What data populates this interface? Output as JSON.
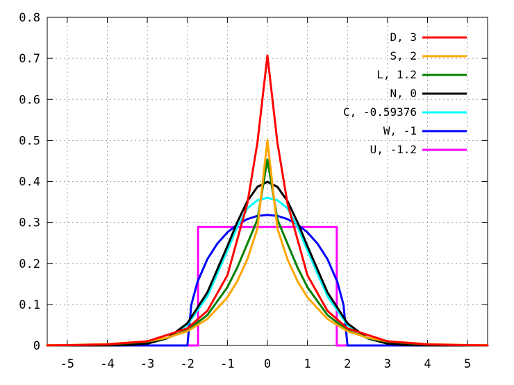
{
  "chart_data": {
    "type": "line",
    "title": "",
    "xlabel": "",
    "ylabel": "",
    "xlim": [
      -5.5,
      5.5
    ],
    "ylim": [
      0,
      0.8
    ],
    "x_ticks": [
      -5,
      -4,
      -3,
      -2,
      -1,
      0,
      1,
      2,
      3,
      4,
      5
    ],
    "x_tick_labels": [
      "-5",
      "-4",
      "-3",
      "-2",
      "-1",
      "0",
      "1",
      "2",
      "3",
      "4",
      "5"
    ],
    "y_ticks": [
      0,
      0.1,
      0.2,
      0.3,
      0.4,
      0.5,
      0.6,
      0.7,
      0.8
    ],
    "y_tick_labels": [
      "0",
      "0.1",
      "0.2",
      "0.3",
      "0.4",
      "0.5",
      "0.6",
      "0.7",
      "0.8"
    ],
    "grid": true,
    "legend_position": "top-right",
    "series": [
      {
        "name": "D, 3",
        "color": "#ff0000",
        "x": [
          -5.5,
          -5,
          -4,
          -3,
          -2,
          -1.5,
          -1,
          -0.5,
          -0.25,
          0,
          0.25,
          0.5,
          1,
          1.5,
          2,
          3,
          4,
          5,
          5.5
        ],
        "y": [
          0.0003,
          0.0006,
          0.0025,
          0.0101,
          0.0416,
          0.0843,
          0.171,
          0.3469,
          0.4941,
          0.7071,
          0.4941,
          0.3469,
          0.171,
          0.0843,
          0.0416,
          0.0101,
          0.0025,
          0.0006,
          0.0003
        ]
      },
      {
        "name": "S, 2",
        "color": "#ffa500",
        "x": [
          -5.5,
          -5,
          -4,
          -3,
          -2.5,
          -2,
          -1.5,
          -1,
          -0.75,
          -0.5,
          -0.25,
          0,
          0.25,
          0.5,
          0.75,
          1,
          1.5,
          2,
          2.5,
          3,
          4,
          5,
          5.5
        ],
        "y": [
          0.0007,
          0.0011,
          0.0033,
          0.0102,
          0.0189,
          0.0348,
          0.0645,
          0.1172,
          0.1572,
          0.2102,
          0.285,
          0.5,
          0.285,
          0.2102,
          0.1572,
          0.1172,
          0.0645,
          0.0348,
          0.0189,
          0.0102,
          0.0033,
          0.0011,
          0.0007
        ]
      },
      {
        "name": "L, 1.2",
        "color": "#008000",
        "x": [
          -5.5,
          -5,
          -4,
          -3,
          -2.5,
          -2,
          -1.5,
          -1,
          -0.75,
          -0.5,
          -0.25,
          0,
          0.25,
          0.5,
          0.75,
          1,
          1.5,
          2,
          2.5,
          3,
          4,
          5,
          5.5
        ],
        "y": [
          0.0003,
          0.0005,
          0.0022,
          0.0089,
          0.0182,
          0.037,
          0.0742,
          0.1419,
          0.1906,
          0.2484,
          0.3068,
          0.4534,
          0.3068,
          0.2484,
          0.1906,
          0.1419,
          0.0742,
          0.037,
          0.0182,
          0.0089,
          0.0022,
          0.0005,
          0.0003
        ]
      },
      {
        "name": "N, 0",
        "color": "#000000",
        "x": [
          -5.5,
          -5,
          -4,
          -3.5,
          -3,
          -2.5,
          -2,
          -1.5,
          -1,
          -0.75,
          -0.5,
          -0.25,
          0,
          0.25,
          0.5,
          0.75,
          1,
          1.5,
          2,
          2.5,
          3,
          3.5,
          4,
          5,
          5.5
        ],
        "y": [
          0.0,
          0.0,
          0.0001,
          0.0009,
          0.0044,
          0.0175,
          0.054,
          0.1295,
          0.242,
          0.3011,
          0.3521,
          0.3867,
          0.3989,
          0.3867,
          0.3521,
          0.3011,
          0.242,
          0.1295,
          0.054,
          0.0175,
          0.0044,
          0.0009,
          0.0001,
          0.0,
          0.0
        ]
      },
      {
        "name": "C, -0.59376",
        "color": "#00ffff",
        "x": [
          -5.5,
          -5,
          -4,
          -3.5,
          -3,
          -2.5,
          -2,
          -1.5,
          -1,
          -0.75,
          -0.5,
          -0.25,
          0,
          0.25,
          0.5,
          0.75,
          1,
          1.5,
          2,
          2.5,
          3,
          3.5,
          4,
          5,
          5.5
        ],
        "y": [
          0.0,
          0.0,
          0.0004,
          0.0015,
          0.0052,
          0.0174,
          0.0502,
          0.1199,
          0.2312,
          0.2897,
          0.3346,
          0.354,
          0.36,
          0.354,
          0.3346,
          0.2897,
          0.2312,
          0.1199,
          0.0502,
          0.0174,
          0.0052,
          0.0015,
          0.0004,
          0.0,
          0.0
        ]
      },
      {
        "name": "W, -1",
        "color": "#0000ff",
        "x": [
          -5.5,
          -2,
          -1.9,
          -1.75,
          -1.5,
          -1.25,
          -1,
          -0.75,
          -0.5,
          -0.25,
          0,
          0.25,
          0.5,
          0.75,
          1,
          1.25,
          1.5,
          1.75,
          1.9,
          2,
          5.5
        ],
        "y": [
          0,
          0,
          0.0993,
          0.1541,
          0.2105,
          0.2485,
          0.2757,
          0.2951,
          0.3082,
          0.3159,
          0.3183,
          0.3159,
          0.3082,
          0.2951,
          0.2757,
          0.2485,
          0.2105,
          0.1541,
          0.0993,
          0,
          0
        ]
      },
      {
        "name": "U, -1.2",
        "color": "#ff00ff",
        "x": [
          -5.5,
          -1.732,
          -1.732,
          1.732,
          1.732,
          5.5
        ],
        "y": [
          0,
          0,
          0.2887,
          0.2887,
          0,
          0
        ]
      }
    ]
  }
}
